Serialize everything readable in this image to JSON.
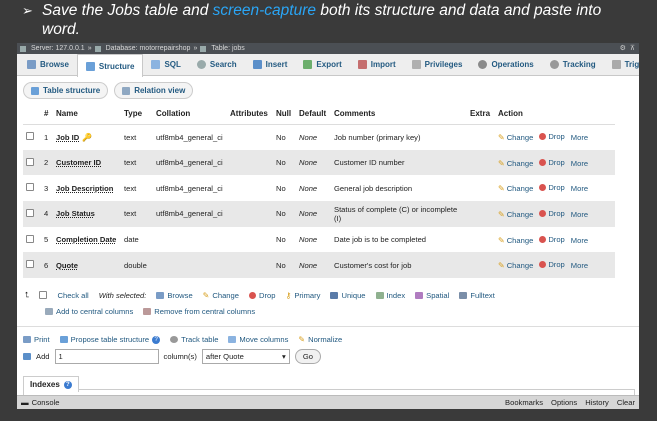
{
  "heading": {
    "bullet": "➢",
    "part1": "Save the Jobs table and ",
    "highlight": "screen-capture",
    "part2": " both its structure and data and paste into word."
  },
  "titlebar": {
    "server": "Server: 127.0.0.1",
    "database": "Database: motorrepairshop",
    "table": "Table: jobs"
  },
  "tabs": [
    {
      "label": "Browse"
    },
    {
      "label": "Structure"
    },
    {
      "label": "SQL"
    },
    {
      "label": "Search"
    },
    {
      "label": "Insert"
    },
    {
      "label": "Export"
    },
    {
      "label": "Import"
    },
    {
      "label": "Privileges"
    },
    {
      "label": "Operations"
    },
    {
      "label": "Tracking"
    },
    {
      "label": "Triggers"
    }
  ],
  "subtabs": {
    "table_structure": "Table structure",
    "relation_view": "Relation view"
  },
  "table": {
    "headers": [
      "#",
      "Name",
      "Type",
      "Collation",
      "Attributes",
      "Null",
      "Default",
      "Comments",
      "Extra",
      "Action"
    ],
    "rows": [
      {
        "num": "1",
        "name": "Job ID",
        "type": "text",
        "collation": "utf8mb4_general_ci",
        "attributes": "",
        "null": "No",
        "default": "None",
        "comment": "Job number (primary key)",
        "extra": ""
      },
      {
        "num": "2",
        "name": "Customer ID",
        "type": "text",
        "collation": "utf8mb4_general_ci",
        "attributes": "",
        "null": "No",
        "default": "None",
        "comment": "Customer ID number",
        "extra": ""
      },
      {
        "num": "3",
        "name": "Job Description",
        "type": "text",
        "collation": "utf8mb4_general_ci",
        "attributes": "",
        "null": "No",
        "default": "None",
        "comment": "General job description",
        "extra": ""
      },
      {
        "num": "4",
        "name": "Job Status",
        "type": "text",
        "collation": "utf8mb4_general_ci",
        "attributes": "",
        "null": "No",
        "default": "None",
        "comment": "Status of complete (C) or incomplete (I)",
        "extra": ""
      },
      {
        "num": "5",
        "name": "Completion Date",
        "type": "date",
        "collation": "",
        "attributes": "",
        "null": "No",
        "default": "None",
        "comment": "Date job is to be completed",
        "extra": ""
      },
      {
        "num": "6",
        "name": "Quote",
        "type": "double",
        "collation": "",
        "attributes": "",
        "null": "No",
        "default": "None",
        "comment": "Customer's cost for job",
        "extra": ""
      }
    ],
    "actions": {
      "change": "Change",
      "drop": "Drop",
      "more": "More"
    }
  },
  "bulk": {
    "check_all": "Check all",
    "with_selected": "With selected:",
    "browse": "Browse",
    "change": "Change",
    "drop": "Drop",
    "primary": "Primary",
    "unique": "Unique",
    "index": "Index",
    "spatial": "Spatial",
    "fulltext": "Fulltext",
    "add_central": "Add to central columns",
    "remove_central": "Remove from central columns"
  },
  "tools": {
    "print": "Print",
    "propose": "Propose table structure",
    "track": "Track table",
    "move": "Move columns",
    "normalize": "Normalize"
  },
  "addrow": {
    "label": "Add",
    "count": "1",
    "columns_label": "column(s)",
    "position": "after Quote",
    "go": "Go"
  },
  "indexes": {
    "label": "Indexes"
  },
  "console": {
    "label": "Console",
    "bookmarks": "Bookmarks",
    "options": "Options",
    "history": "History",
    "clear": "Clear"
  },
  "colors": {
    "link": "#235a81",
    "highlight": "#2aa5f5",
    "drop": "#d9534f",
    "row_alt": "#e8e8e8"
  }
}
